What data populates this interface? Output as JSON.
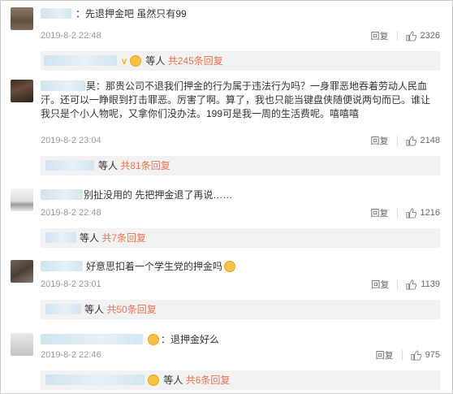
{
  "comments": [
    {
      "text": "：先退押金吧 虽然只有99",
      "date": "2019-8-2 22:48",
      "reply_label": "回复",
      "likes": "2326",
      "thread_users_label": "等人",
      "thread_link": "共245条回复"
    },
    {
      "text_prefix": "昊：",
      "text": "那贵公司不退我们押金的行为属于违法行为吗？一身罪恶地吞着劳动人民血汗。还可以一睁眼到打击罪恶。厉害了啊。算了，我也只能当键盘侠随便说两句而已。谁让我只是个小人物呢，又拿你们没办法。199可是我一周的生活费呢。嘻嘻嘻",
      "date": "2019-8-2 23:04",
      "reply_label": "回复",
      "likes": "2148",
      "thread_users_label": "等人",
      "thread_link": "共81条回复"
    },
    {
      "text": "别扯没用的 先把押金退了再说……",
      "date": "2019-8-2 22:48",
      "reply_label": "回复",
      "likes": "1216",
      "thread_users_label": "等人",
      "thread_link": "共7条回复"
    },
    {
      "text": "好意思扣着一个学生党的押金吗",
      "date": "2019-8-2 23:01",
      "reply_label": "回复",
      "likes": "1139",
      "thread_users_label": "等人",
      "thread_link": "共50条回复"
    },
    {
      "text": "：退押金好么",
      "date": "2019-8-2 22:46",
      "reply_label": "回复",
      "likes": "975",
      "thread_users_label": "等人",
      "thread_link": "共6条回复"
    }
  ],
  "colors": {
    "link": "#eb7350",
    "meta": "#999999",
    "reply_box_bg": "#f2f2f2",
    "name_blur": "#d3e7f2"
  },
  "icons": [
    "thumb-up-icon",
    "emoji-icon",
    "vip-badge-icon"
  ]
}
